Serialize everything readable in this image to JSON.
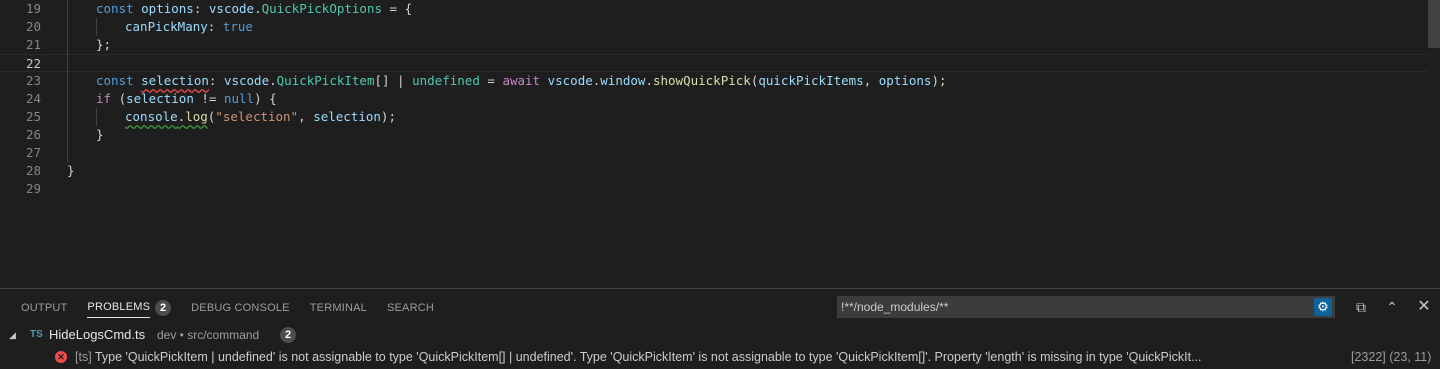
{
  "editor": {
    "lines": [
      {
        "num": "19",
        "tokens": [
          [
            "kw",
            "const "
          ],
          [
            "var",
            "options"
          ],
          [
            "",
            "∶ "
          ],
          [
            "var",
            "vscode"
          ],
          [
            "",
            "."
          ],
          [
            "typ",
            "QuickPickOptions"
          ],
          [
            "",
            " = {"
          ]
        ]
      },
      {
        "num": "20",
        "tokens": [
          [
            "var",
            "canPickMany"
          ],
          [
            "",
            ": "
          ],
          [
            "kw",
            "true"
          ]
        ]
      },
      {
        "num": "21",
        "tokens": [
          [
            "",
            "};"
          ]
        ]
      },
      {
        "num": "22",
        "tokens": []
      },
      {
        "num": "23",
        "tokens": [
          [
            "kw",
            "const "
          ],
          [
            "var err",
            "selection"
          ],
          [
            "",
            ": "
          ],
          [
            "var",
            "vscode"
          ],
          [
            "",
            "."
          ],
          [
            "typ",
            "QuickPickItem"
          ],
          [
            "",
            "[] | "
          ],
          [
            "typ",
            "undefined"
          ],
          [
            "",
            " = "
          ],
          [
            "ctl",
            "await "
          ],
          [
            "var",
            "vscode"
          ],
          [
            "",
            "."
          ],
          [
            "var",
            "window"
          ],
          [
            "",
            "."
          ],
          [
            "fn",
            "showQuickPick"
          ],
          [
            "",
            "("
          ],
          [
            "var",
            "quickPickItems"
          ],
          [
            "",
            ", "
          ],
          [
            "var",
            "options"
          ],
          [
            "",
            ");"
          ]
        ]
      },
      {
        "num": "24",
        "tokens": [
          [
            "ctl",
            "if "
          ],
          [
            "",
            "("
          ],
          [
            "var",
            "selection"
          ],
          [
            "",
            " != "
          ],
          [
            "kw",
            "null"
          ],
          [
            "",
            ") {"
          ]
        ]
      },
      {
        "num": "25",
        "tokens": [
          [
            "var warn",
            "console"
          ],
          [
            "warn",
            "."
          ],
          [
            "fn warn",
            "log"
          ],
          [
            "",
            "("
          ],
          [
            "str",
            "\"selection\""
          ],
          [
            "",
            ", "
          ],
          [
            "var",
            "selection"
          ],
          [
            "",
            ");"
          ]
        ]
      },
      {
        "num": "26",
        "tokens": [
          [
            "",
            "}"
          ]
        ]
      },
      {
        "num": "27",
        "tokens": []
      },
      {
        "num": "28",
        "tokens": [
          [
            "",
            "}"
          ]
        ]
      },
      {
        "num": "29",
        "tokens": []
      }
    ],
    "active_line": "22"
  },
  "panel": {
    "tabs": [
      {
        "label": "OUTPUT",
        "active": false
      },
      {
        "label": "PROBLEMS",
        "active": true,
        "badge": "2"
      },
      {
        "label": "DEBUG CONSOLE",
        "active": false
      },
      {
        "label": "TERMINAL",
        "active": false
      },
      {
        "label": "SEARCH",
        "active": false
      }
    ],
    "filter_value": "!**/node_modules/**",
    "file": {
      "name": "HideLogsCmd.ts",
      "icon_text": "TS",
      "description": "dev • src/command",
      "count": "2"
    },
    "problem": {
      "source": "[ts]",
      "message": "Type 'QuickPickItem | undefined' is not assignable to type 'QuickPickItem[] | undefined'. Type 'QuickPickItem' is not assignable to type 'QuickPickItem[]'. Property 'length' is missing in type 'QuickPickIt...",
      "code": "[2322]",
      "location": "(23, 11)"
    }
  }
}
